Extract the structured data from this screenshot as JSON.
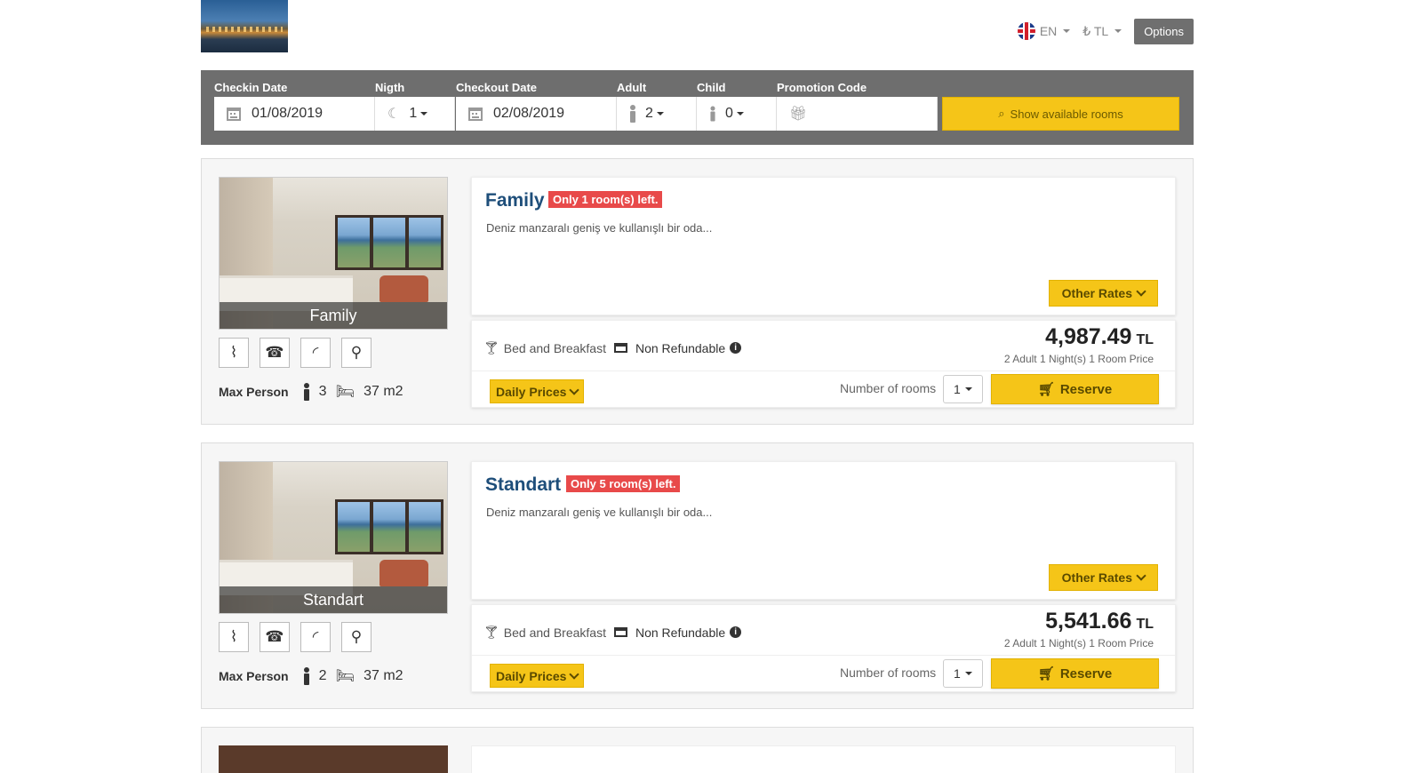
{
  "header": {
    "lang": "EN",
    "currency": "₺ TL",
    "options_label": "Options"
  },
  "search": {
    "checkin_label": "Checkin Date",
    "checkin_value": "01/08/2019",
    "night_label": "Nigth",
    "night_value": "1",
    "checkout_label": "Checkout Date",
    "checkout_value": "02/08/2019",
    "adult_label": "Adult",
    "adult_value": "2",
    "child_label": "Child",
    "child_value": "0",
    "promo_label": "Promotion Code",
    "promo_value": "",
    "show_label": "Show available rooms"
  },
  "rooms": [
    {
      "name": "Family",
      "badge": "Only 1 room(s) left.",
      "description": "Deniz manzaralı geniş ve kullanışlı bir oda...",
      "other_rates": "Other Rates",
      "max_person_label": "Max Person",
      "max_person": "3",
      "size": "37 m2",
      "board": "Bed and Breakfast",
      "refund": "Non Refundable",
      "price": "4,987.49",
      "price_currency": "TL",
      "price_note": "2 Adult 1 Night(s) 1 Room Price",
      "daily_prices": "Daily Prices",
      "rooms_label": "Number of rooms",
      "rooms_count": "1",
      "reserve": "Reserve"
    },
    {
      "name": "Standart",
      "badge": "Only 5 room(s) left.",
      "description": "Deniz manzaralı geniş ve kullanışlı bir oda...",
      "other_rates": "Other Rates",
      "max_person_label": "Max Person",
      "max_person": "2",
      "size": "37 m2",
      "board": "Bed and Breakfast",
      "refund": "Non Refundable",
      "price": "5,541.66",
      "price_currency": "TL",
      "price_note": "2 Adult 1 Night(s) 1 Room Price",
      "daily_prices": "Daily Prices",
      "rooms_label": "Number of rooms",
      "rooms_count": "1",
      "reserve": "Reserve"
    }
  ],
  "icons": {
    "amenities": [
      "shower-icon",
      "phone-icon",
      "wifi-icon",
      "hairdryer-icon"
    ]
  },
  "colors": {
    "accent_yellow": "#f5c518",
    "badge_red": "#e84a4a",
    "room_title": "#1e4e7a",
    "search_bar": "#6e6e6e"
  }
}
